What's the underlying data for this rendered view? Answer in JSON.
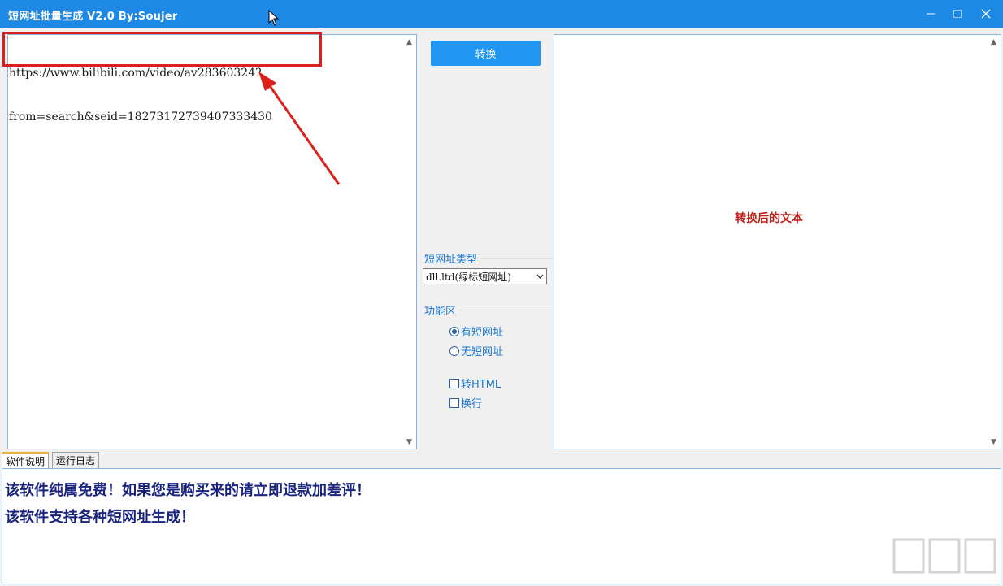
{
  "window": {
    "title": "短网址批量生成   V2.0 By:Soujer",
    "controls": {
      "minimize": "—",
      "maximize": "☐",
      "close": "✕"
    }
  },
  "input": {
    "url_line1": "https://www.bilibili.com/video/av28360324?",
    "url_line2": "from=search&seid=18273172739407333430"
  },
  "convert_button": "转换",
  "short_url_type": {
    "label": "短网址类型",
    "selected": "dll.ltd(绿标短网址)"
  },
  "function_area": {
    "label": "功能区",
    "radios": [
      {
        "label": "有短网址",
        "checked": true
      },
      {
        "label": "无短网址",
        "checked": false
      }
    ],
    "checkboxes": [
      {
        "label": "转HTML",
        "checked": false
      },
      {
        "label": "换行",
        "checked": false
      }
    ]
  },
  "output": {
    "placeholder": "转换后的文本"
  },
  "tabs": [
    {
      "label": "软件说明",
      "active": true
    },
    {
      "label": "运行日志",
      "active": false
    }
  ],
  "info": {
    "line1": "该软件纯属免费！如果您是购买来的请立即退款加差评！",
    "line2": "该软件支持各种短网址生成！"
  },
  "colors": {
    "titlebar": "#1e88e5",
    "button": "#2196f3",
    "highlight": "#d9201a",
    "info_text": "#1a237e"
  }
}
